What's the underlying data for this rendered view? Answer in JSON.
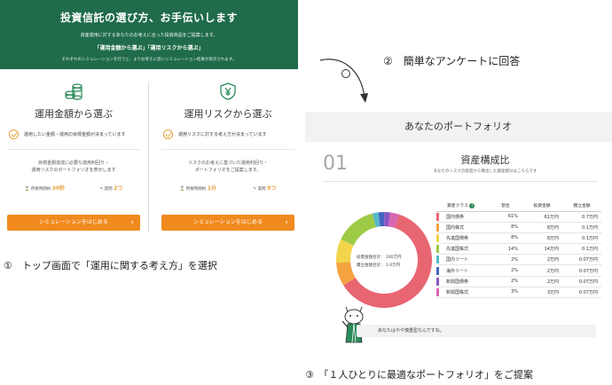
{
  "left_panel": {
    "banner": {
      "title": "投資信託の選び方、お手伝いします",
      "sub": "資産運用に対するあなたのお考えに合った投資商品をご提案します。",
      "tabs": "「運用金額から選ぶ」「運用リスクから選ぶ」",
      "note": "それぞれのシミュレーションを行うと、よりお考えに近いシミュレーション結果が表示されます。"
    },
    "columns": [
      {
        "icon": "coins-icon",
        "heading": "運用金額から選ぶ",
        "check": "運用したい金額・運用の目標金額が決まっています",
        "desc_line1": "目標金額達成に必要な運用利回り・",
        "desc_line2": "運用リスクのポートフォリオを表示します",
        "time_label": "所要時間約",
        "time_value": "30秒",
        "questions_label": "質問",
        "questions_value": "2つ",
        "button": "シミュレーションをはじめる"
      },
      {
        "icon": "yen-shield-icon",
        "heading": "運用リスクから選ぶ",
        "check": "運用リスクに対する考え方が決まっています",
        "desc_line1": "リスクのお考えに基づいた運用利回り・",
        "desc_line2": "ポートフォリオをご提案します。",
        "time_label": "所要時間約",
        "time_value": "1分",
        "questions_label": "質問",
        "questions_value": "9つ",
        "button": "シミュレーションをはじめる"
      }
    ]
  },
  "captions": {
    "step1": "①　トップ画面で「運用に関する考え方」を選択",
    "step2": "②　簡単なアンケートに回答",
    "step3": "③　「１人ひとりに最適なポートフォリオ」をご提案"
  },
  "right_panel": {
    "header": "あなたのポートフォリオ",
    "number": "01",
    "title": "資産構成比",
    "subtitle": "あなたのリスク許容度から算出した資産配分はこちらです",
    "donut_labels": {
      "invest_label": "投資金額合計：",
      "invest_value": "100万円",
      "reserve_label": "積立金額合計：",
      "reserve_value": "1.0万円"
    },
    "table": {
      "headers": [
        "資産クラス",
        "割合",
        "投資金額",
        "積立金額"
      ],
      "rows": [
        {
          "name": "国内債券",
          "ratio": "61%",
          "invest": "61万円",
          "reserve": "0.7万円",
          "color": "#e86672",
          "value": 61
        },
        {
          "name": "国内株式",
          "ratio": "8%",
          "invest": "8万円",
          "reserve": "0.1万円",
          "color": "#f4a340",
          "value": 8
        },
        {
          "name": "先進国債券",
          "ratio": "8%",
          "invest": "8万円",
          "reserve": "0.1万円",
          "color": "#f2d54b",
          "value": 8
        },
        {
          "name": "先進国株式",
          "ratio": "14%",
          "invest": "14万円",
          "reserve": "0.1万円",
          "color": "#9ecb47",
          "value": 14
        },
        {
          "name": "国内リート",
          "ratio": "2%",
          "invest": "2万円",
          "reserve": "0.07万円",
          "color": "#55b8c9",
          "value": 2
        },
        {
          "name": "海外リート",
          "ratio": "2%",
          "invest": "2万円",
          "reserve": "0.07万円",
          "color": "#4466c2",
          "value": 2
        },
        {
          "name": "新興国債券",
          "ratio": "2%",
          "invest": "2万円",
          "reserve": "0.07万円",
          "color": "#8a56c2",
          "value": 2
        },
        {
          "name": "新興国株式",
          "ratio": "3%",
          "invest": "3万円",
          "reserve": "0.07万円",
          "color": "#d868b0",
          "value": 3
        }
      ]
    },
    "speech": "あなたはやや慎重型なんですね。"
  }
}
